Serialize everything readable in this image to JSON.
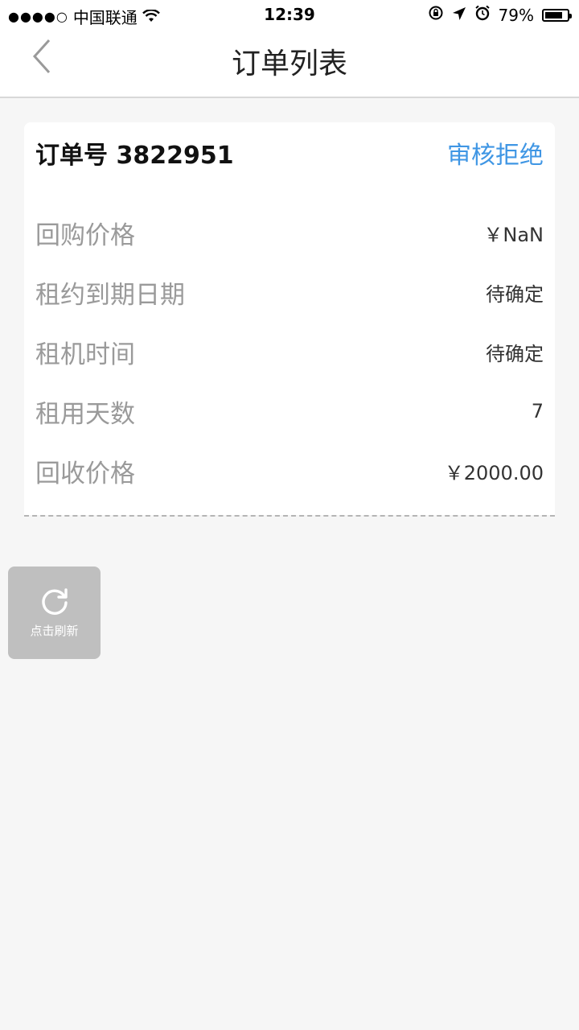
{
  "status_bar": {
    "signal": "●●●●○",
    "carrier": "中国联通",
    "time": "12:39",
    "battery_percent": "79%",
    "battery_level": 0.79
  },
  "nav": {
    "title": "订单列表"
  },
  "order": {
    "order_no": "订单号 3822951",
    "status": "审核拒绝",
    "status_color": "#3f96e4",
    "rows": [
      {
        "label": "回购价格",
        "value": "￥NaN"
      },
      {
        "label": "租约到期日期",
        "value": "待确定"
      },
      {
        "label": "租机时间",
        "value": "待确定"
      },
      {
        "label": "租用天数",
        "value": "7"
      },
      {
        "label": "回收价格",
        "value": "￥2000.00"
      }
    ]
  },
  "refresh": {
    "label": "点击刷新",
    "icon": "refresh-icon"
  }
}
